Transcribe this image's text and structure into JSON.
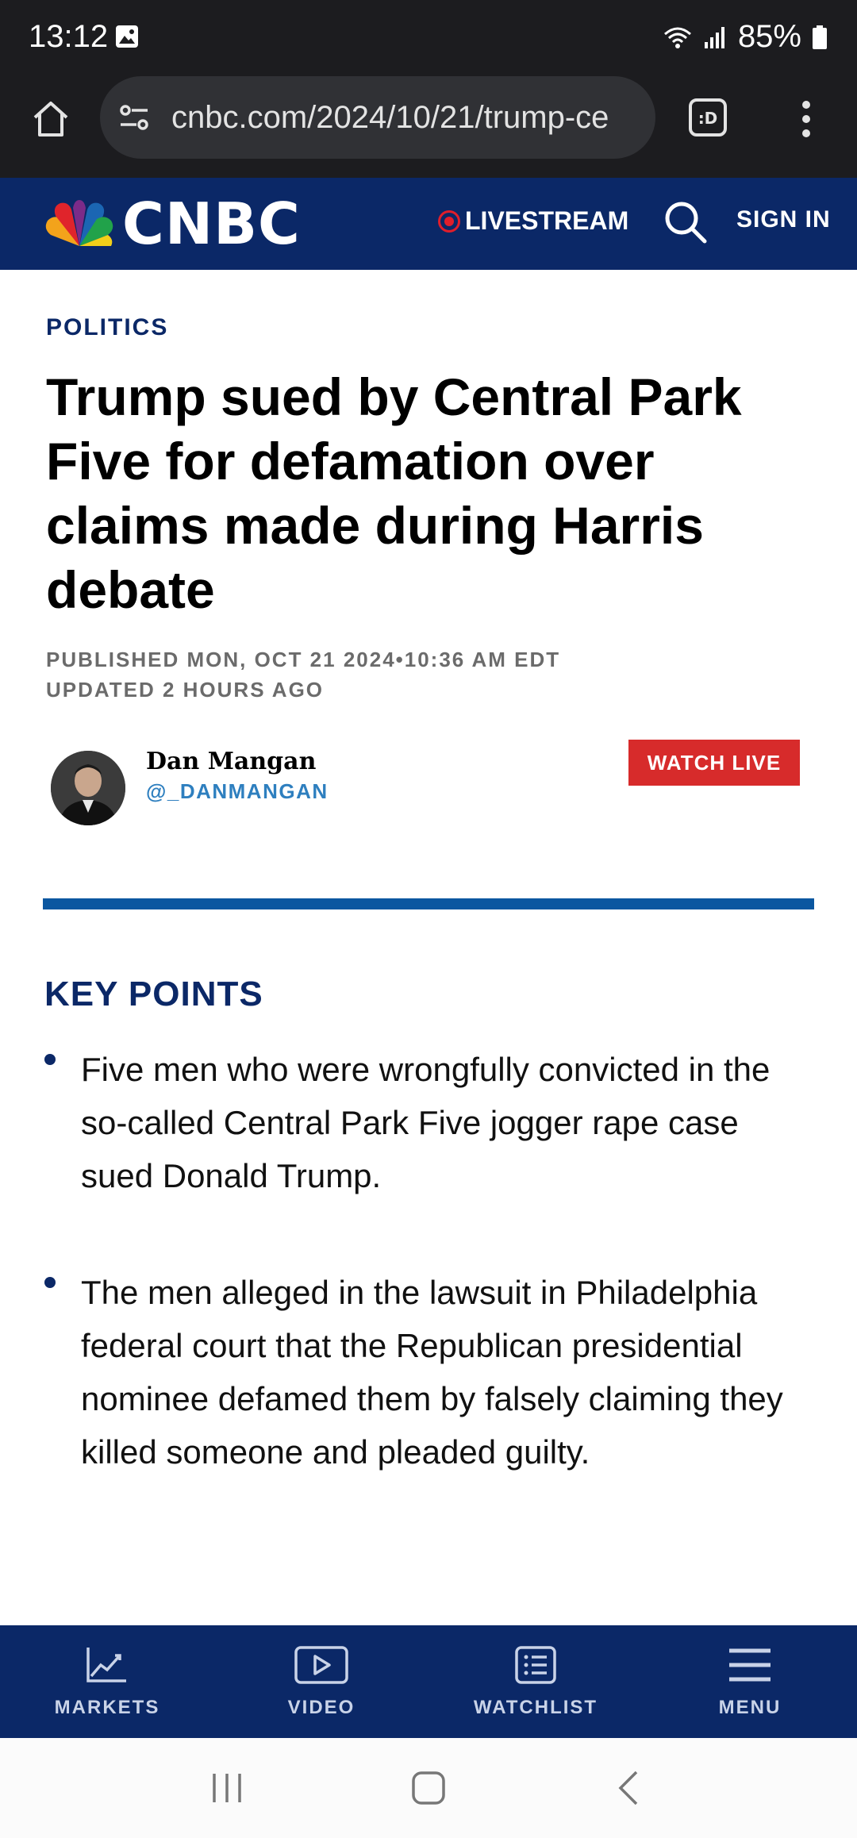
{
  "status_bar": {
    "time": "13:12",
    "battery": "85%"
  },
  "browser": {
    "url": "cnbc.com/2024/10/21/trump-ce"
  },
  "header": {
    "logo_text": "CNBC",
    "livestream_label": "LIVESTREAM",
    "sign_in_label": "SIGN IN"
  },
  "article": {
    "section": "POLITICS",
    "headline": "Trump sued by Central Park Five for defamation over claims made during Harris debate",
    "published": "PUBLISHED MON, OCT 21 2024•10:36 AM EDT",
    "updated": "UPDATED 2 HOURS AGO",
    "author": {
      "name": "Dan Mangan",
      "handle": "@_DANMANGAN"
    },
    "watch_live_label": "WATCH LIVE",
    "key_points_title": "KEY POINTS",
    "key_points": [
      "Five men who were wrongfully convicted in the so-called Central Park Five jogger rape case sued Donald Trump.",
      "The men alleged in the lawsuit in Philadelphia federal court that the Republican presidential nominee defamed them by falsely claiming they killed someone and pleaded guilty."
    ]
  },
  "bottom_nav": {
    "items": [
      {
        "label": "MARKETS",
        "icon": "chart-line-icon"
      },
      {
        "label": "VIDEO",
        "icon": "video-play-icon"
      },
      {
        "label": "WATCHLIST",
        "icon": "list-icon"
      },
      {
        "label": "MENU",
        "icon": "hamburger-menu-icon"
      }
    ]
  },
  "colors": {
    "brand_navy": "#0b2867",
    "accent_blue": "#0b57a0",
    "live_red": "#d72b2b",
    "handle_blue": "#2e7fbf"
  }
}
